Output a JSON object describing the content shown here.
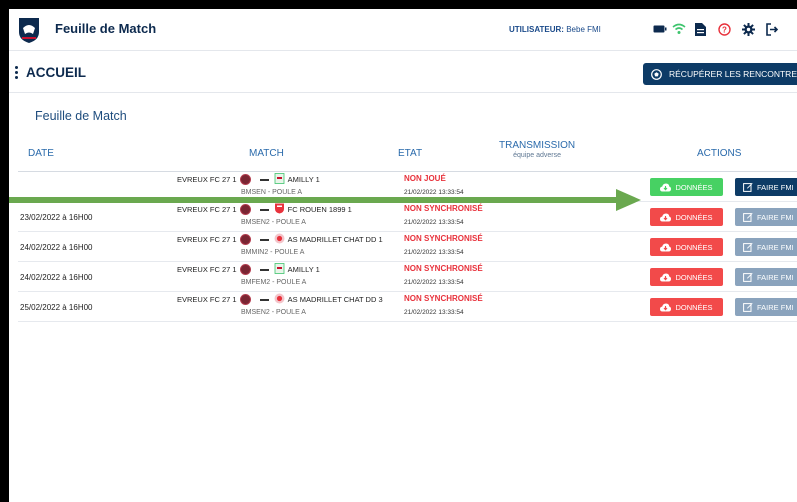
{
  "app": {
    "title": "Feuille de Match"
  },
  "user": {
    "label": "UTILISATEUR:",
    "name": "Bebe FMI"
  },
  "icons": {
    "battery": "battery-icon",
    "wifi": "wifi-icon",
    "document": "document-icon",
    "help": "help-icon",
    "settings": "gear-icon",
    "logout": "logout-icon"
  },
  "page": {
    "title": "ACCUEIL",
    "fetch_button": "RÉCUPÉRER LES RENCONTRES"
  },
  "card": {
    "title": "Feuille de Match"
  },
  "table": {
    "headers": {
      "date": "DATE",
      "match": "MATCH",
      "state": "ETAT",
      "transmission": "TRANSMISSION",
      "transmission_sub": "équipe adverse",
      "actions": "ACTIONS"
    },
    "rows": [
      {
        "date": "",
        "home": "EVREUX FC 27 1",
        "away": "AMILLY 1",
        "group": "BMSEN - POULE A",
        "state": "NON JOUÉ",
        "time": "21/02/2022 13:33:54",
        "data_button": "DONNÉES",
        "fmi_button": "FAIRE FMI"
      },
      {
        "date": "23/02/2022 à 16H00",
        "home": "EVREUX FC 27 1",
        "away": "FC ROUEN 1899 1",
        "group": "BMSEN2 - POULE A",
        "state": "NON SYNCHRONISÉ",
        "time": "21/02/2022 13:33:54",
        "data_button": "DONNÉES",
        "fmi_button": "FAIRE FMI"
      },
      {
        "date": "24/02/2022 à 16H00",
        "home": "EVREUX FC 27 1",
        "away": "AS MADRILLET CHAT DD 1",
        "group": "BMMIN2 - POULE A",
        "state": "NON SYNCHRONISÉ",
        "time": "21/02/2022 13:33:54",
        "data_button": "DONNÉES",
        "fmi_button": "FAIRE FMI"
      },
      {
        "date": "24/02/2022 à 16H00",
        "home": "EVREUX FC 27 1",
        "away": "AMILLY 1",
        "group": "BMFEM2 - POULE A",
        "state": "NON SYNCHRONISÉ",
        "time": "21/02/2022 13:33:54",
        "data_button": "DONNÉES",
        "fmi_button": "FAIRE FMI"
      },
      {
        "date": "25/02/2022 à 16H00",
        "home": "EVREUX FC 27 1",
        "away": "AS MADRILLET CHAT DD 3",
        "group": "BMSEN2 - POULE A",
        "state": "NON SYNCHRONISÉ",
        "time": "21/02/2022 13:33:54",
        "data_button": "DONNÉES",
        "fmi_button": "FAIRE FMI"
      }
    ]
  },
  "colors": {
    "navy": "#0d3b66",
    "green": "#47d163",
    "red": "#f24a4a",
    "disabled": "#8aa3bd",
    "state_red": "#e8323c",
    "annotation_arrow": "#6aa84f"
  }
}
